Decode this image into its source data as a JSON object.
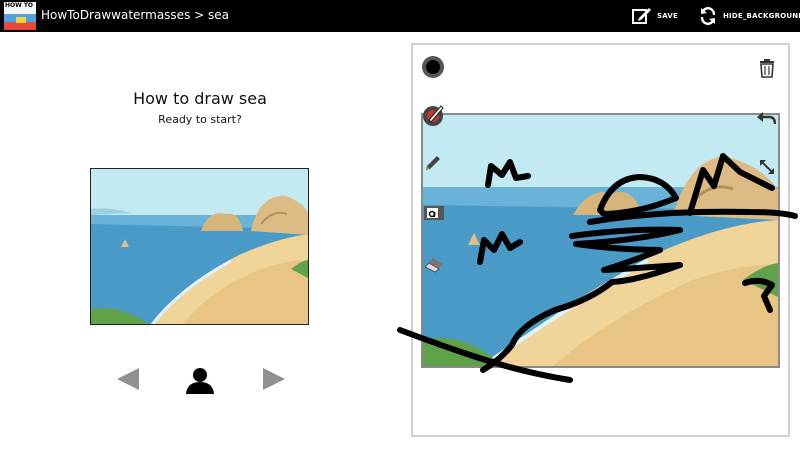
{
  "header": {
    "app_icon_text": "HOW TO",
    "breadcrumb": "HowToDrawwatermasses > sea",
    "save_label": "SAVE",
    "hide_background_label": "HIDE_BACKGROUND"
  },
  "lesson": {
    "title": "How to draw sea",
    "subtitle": "Ready to start?"
  },
  "navigation": {
    "prev_icon": "triangle-left-icon",
    "person_icon": "person-icon",
    "next_icon": "triangle-right-icon"
  },
  "drawing_tools": [
    "color-dot-icon",
    "brush-size-icon",
    "pencil-icon",
    "text-icon",
    "eraser-icon",
    "trash-icon",
    "undo-icon",
    "resize-icon"
  ],
  "colors": {
    "topbar": "#000000",
    "sky": "#bfe7f0",
    "sea": "#4a9ac8",
    "sand": "#f0d49a",
    "rock": "#d9b77e",
    "stroke": "#000000"
  }
}
